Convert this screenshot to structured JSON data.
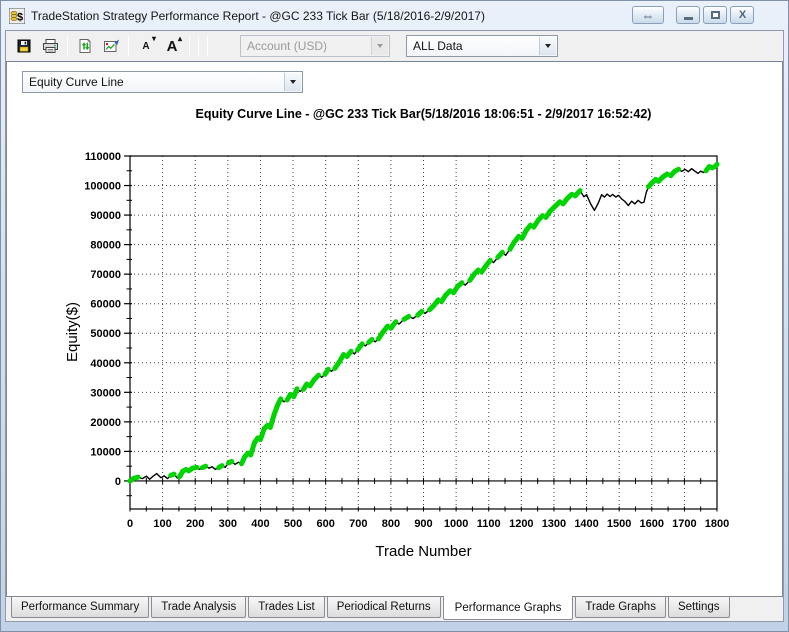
{
  "window": {
    "title": "TradeStation Strategy Performance Report - @GC 233 Tick Bar (5/18/2016-2/9/2017)",
    "controls": {
      "dock_glyph": "⇔",
      "close_glyph": "X"
    }
  },
  "toolbar": {
    "icons": [
      "save-icon",
      "print-icon",
      "refresh-icon",
      "export-graph-icon"
    ],
    "font_decrease": {
      "letter": "A",
      "arrow": "▾"
    },
    "font_increase": {
      "letter": "A",
      "arrow": "▴"
    },
    "account_combo": {
      "value": "Account (USD)",
      "disabled": true
    },
    "data_range_combo": {
      "value": "ALL Data"
    }
  },
  "report": {
    "graph_type_combo": {
      "value": "Equity Curve Line"
    }
  },
  "chart_data": {
    "type": "line",
    "title": "Equity Curve Line - @GC 233 Tick Bar(5/18/2016 18:06:51 - 2/9/2017 16:52:42)",
    "xlabel": "Trade Number",
    "ylabel": "Equity($)",
    "xlim": [
      0,
      1800
    ],
    "ylim": [
      -9500,
      110000
    ],
    "x_ticks": [
      0,
      100,
      200,
      300,
      400,
      500,
      600,
      700,
      800,
      900,
      1000,
      1100,
      1200,
      1300,
      1400,
      1500,
      1600,
      1700,
      1800
    ],
    "y_ticks": [
      0,
      10000,
      20000,
      30000,
      40000,
      50000,
      60000,
      70000,
      80000,
      90000,
      100000,
      110000
    ],
    "x_minor_step": 50,
    "y_minor_step": 5000,
    "grid": "dotted",
    "colors": {
      "line": "#000000",
      "runup": "#00d400"
    },
    "series": [
      {
        "name": "Equity",
        "points": [
          [
            0,
            0,
            1
          ],
          [
            12,
            900,
            1
          ],
          [
            25,
            1300,
            0
          ],
          [
            38,
            800,
            0
          ],
          [
            50,
            1600,
            0
          ],
          [
            60,
            600,
            0
          ],
          [
            72,
            1700,
            0
          ],
          [
            82,
            2500,
            0
          ],
          [
            95,
            1100,
            0
          ],
          [
            105,
            1700,
            0
          ],
          [
            115,
            800,
            0
          ],
          [
            125,
            1900,
            1
          ],
          [
            135,
            2300,
            0
          ],
          [
            145,
            1000,
            0
          ],
          [
            152,
            1400,
            1
          ],
          [
            162,
            3300,
            1
          ],
          [
            172,
            3900,
            0
          ],
          [
            180,
            3400,
            1
          ],
          [
            192,
            4300,
            1
          ],
          [
            205,
            4600,
            0
          ],
          [
            213,
            3900,
            0
          ],
          [
            222,
            4500,
            1
          ],
          [
            232,
            5000,
            0
          ],
          [
            242,
            4300,
            0
          ],
          [
            252,
            4800,
            0
          ],
          [
            262,
            3900,
            0
          ],
          [
            272,
            4500,
            1
          ],
          [
            282,
            5200,
            0
          ],
          [
            292,
            4600,
            0
          ],
          [
            302,
            6100,
            1
          ],
          [
            312,
            6600,
            0
          ],
          [
            322,
            5600,
            0
          ],
          [
            332,
            6300,
            0
          ],
          [
            342,
            5800,
            1
          ],
          [
            352,
            8200,
            1
          ],
          [
            362,
            9400,
            0
          ],
          [
            370,
            8800,
            1
          ],
          [
            382,
            13000,
            1
          ],
          [
            392,
            14600,
            0
          ],
          [
            400,
            14000,
            1
          ],
          [
            412,
            17800,
            1
          ],
          [
            422,
            18800,
            0
          ],
          [
            430,
            18100,
            1
          ],
          [
            442,
            22500,
            1
          ],
          [
            452,
            25500,
            1
          ],
          [
            462,
            27800,
            0
          ],
          [
            472,
            26800,
            0
          ],
          [
            482,
            27400,
            1
          ],
          [
            492,
            29300,
            0
          ],
          [
            502,
            28500,
            1
          ],
          [
            512,
            31200,
            0
          ],
          [
            522,
            30300,
            0
          ],
          [
            532,
            31000,
            1
          ],
          [
            542,
            32800,
            0
          ],
          [
            552,
            32200,
            1
          ],
          [
            565,
            34300,
            1
          ],
          [
            578,
            35800,
            0
          ],
          [
            588,
            35100,
            0
          ],
          [
            598,
            36100,
            1
          ],
          [
            608,
            37800,
            0
          ],
          [
            618,
            37100,
            0
          ],
          [
            628,
            38100,
            1
          ],
          [
            642,
            40300,
            1
          ],
          [
            655,
            42800,
            0
          ],
          [
            665,
            42100,
            1
          ],
          [
            678,
            43900,
            0
          ],
          [
            688,
            43000,
            0
          ],
          [
            698,
            44400,
            1
          ],
          [
            712,
            46400,
            0
          ],
          [
            722,
            45700,
            0
          ],
          [
            732,
            46900,
            1
          ],
          [
            742,
            47900,
            0
          ],
          [
            752,
            47100,
            0
          ],
          [
            762,
            48100,
            1
          ],
          [
            775,
            50300,
            1
          ],
          [
            790,
            52400,
            0
          ],
          [
            800,
            51700,
            1
          ],
          [
            815,
            53900,
            0
          ],
          [
            825,
            53100,
            0
          ],
          [
            840,
            54700,
            1
          ],
          [
            855,
            55700,
            0
          ],
          [
            868,
            55000,
            0
          ],
          [
            882,
            56100,
            1
          ],
          [
            895,
            57400,
            0
          ],
          [
            905,
            56700,
            0
          ],
          [
            918,
            57900,
            1
          ],
          [
            932,
            59400,
            1
          ],
          [
            945,
            61300,
            0
          ],
          [
            955,
            60700,
            1
          ],
          [
            968,
            62900,
            1
          ],
          [
            982,
            64400,
            0
          ],
          [
            992,
            63700,
            1
          ],
          [
            1005,
            65900,
            1
          ],
          [
            1018,
            67100,
            0
          ],
          [
            1028,
            66300,
            0
          ],
          [
            1042,
            67900,
            1
          ],
          [
            1055,
            69900,
            1
          ],
          [
            1068,
            71400,
            0
          ],
          [
            1078,
            70700,
            1
          ],
          [
            1092,
            72900,
            1
          ],
          [
            1105,
            74700,
            0
          ],
          [
            1115,
            73900,
            0
          ],
          [
            1128,
            75700,
            1
          ],
          [
            1142,
            77400,
            0
          ],
          [
            1152,
            76400,
            0
          ],
          [
            1165,
            78400,
            1
          ],
          [
            1178,
            80800,
            1
          ],
          [
            1192,
            82800,
            0
          ],
          [
            1202,
            82100,
            1
          ],
          [
            1215,
            84800,
            1
          ],
          [
            1228,
            86600,
            0
          ],
          [
            1238,
            85900,
            1
          ],
          [
            1252,
            88300,
            1
          ],
          [
            1265,
            89800,
            0
          ],
          [
            1275,
            89200,
            1
          ],
          [
            1288,
            91300,
            1
          ],
          [
            1302,
            92800,
            1
          ],
          [
            1318,
            94500,
            0
          ],
          [
            1328,
            93800,
            1
          ],
          [
            1342,
            95800,
            1
          ],
          [
            1355,
            97000,
            0
          ],
          [
            1365,
            96500,
            1
          ],
          [
            1380,
            98300,
            0
          ],
          [
            1392,
            96200,
            0
          ],
          [
            1400,
            96900,
            0
          ],
          [
            1412,
            93900,
            0
          ],
          [
            1424,
            91600,
            0
          ],
          [
            1436,
            94100,
            0
          ],
          [
            1446,
            96900,
            0
          ],
          [
            1455,
            96100,
            0
          ],
          [
            1463,
            97100,
            0
          ],
          [
            1472,
            96300,
            0
          ],
          [
            1480,
            97000,
            0
          ],
          [
            1490,
            96100,
            0
          ],
          [
            1498,
            96700,
            0
          ],
          [
            1508,
            95400,
            0
          ],
          [
            1518,
            94600,
            0
          ],
          [
            1528,
            93200,
            0
          ],
          [
            1538,
            94700,
            0
          ],
          [
            1548,
            93800,
            0
          ],
          [
            1558,
            95000,
            0
          ],
          [
            1568,
            94100,
            0
          ],
          [
            1576,
            94400,
            0
          ],
          [
            1583,
            97600,
            0
          ],
          [
            1590,
            99600,
            1
          ],
          [
            1602,
            101100,
            1
          ],
          [
            1612,
            102100,
            0
          ],
          [
            1620,
            101400,
            1
          ],
          [
            1634,
            102900,
            1
          ],
          [
            1647,
            103900,
            0
          ],
          [
            1658,
            103300,
            1
          ],
          [
            1670,
            104800,
            1
          ],
          [
            1682,
            105500,
            0
          ],
          [
            1692,
            104800,
            0
          ],
          [
            1702,
            105500,
            0
          ],
          [
            1712,
            104700,
            0
          ],
          [
            1722,
            105700,
            0
          ],
          [
            1732,
            104900,
            0
          ],
          [
            1742,
            104100,
            0
          ],
          [
            1750,
            104900,
            0
          ],
          [
            1758,
            104400,
            0
          ],
          [
            1766,
            105000,
            1
          ],
          [
            1776,
            106400,
            1
          ],
          [
            1786,
            106000,
            0
          ],
          [
            1793,
            106300,
            1
          ],
          [
            1800,
            107200,
            0
          ]
        ]
      }
    ]
  },
  "tabs": [
    {
      "label": "Performance Summary",
      "active": false
    },
    {
      "label": "Trade Analysis",
      "active": false
    },
    {
      "label": "Trades List",
      "active": false
    },
    {
      "label": "Periodical Returns",
      "active": false
    },
    {
      "label": "Performance Graphs",
      "active": true
    },
    {
      "label": "Trade Graphs",
      "active": false
    },
    {
      "label": "Settings",
      "active": false
    }
  ]
}
